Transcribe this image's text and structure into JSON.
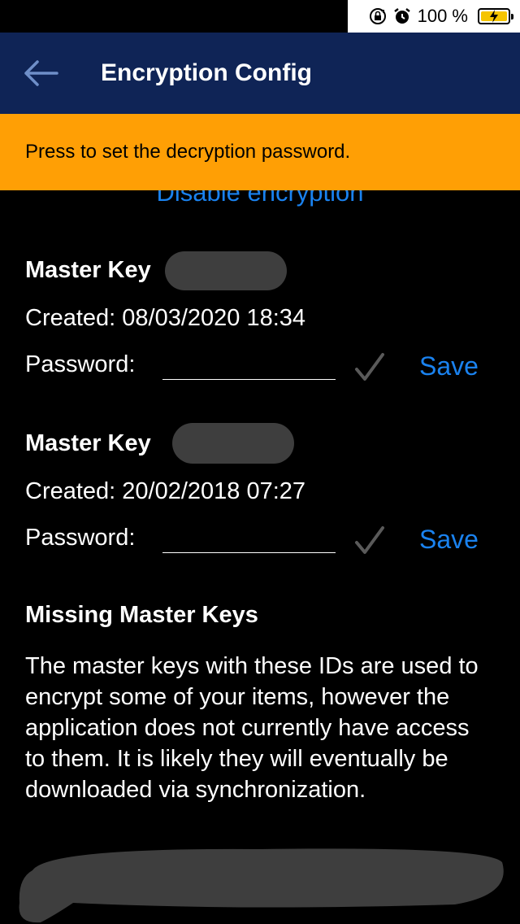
{
  "status_bar": {
    "battery_text": "100 %",
    "battery_level": 1.0
  },
  "header": {
    "title": "Encryption Config"
  },
  "banner": {
    "text": "Press to set the decryption password."
  },
  "disable_link": "Disable encryption",
  "master_keys": [
    {
      "title": "Master Key",
      "created": "Created: 08/03/2020 18:34",
      "password_label": "Password:",
      "password_value": "",
      "save_label": "Save"
    },
    {
      "title": "Master Key",
      "created": "Created: 20/02/2018 07:27",
      "password_label": "Password:",
      "password_value": "",
      "save_label": "Save"
    }
  ],
  "missing": {
    "title": "Missing Master Keys",
    "description": "The master keys with these IDs are used to encrypt some of your items, however the application does not currently have access to them. It is likely they will eventually be downloaded via synchronization."
  },
  "colors": {
    "header_bg": "#0f2456",
    "banner_bg": "#ff9f05",
    "link": "#1a82ef",
    "background": "#000000"
  }
}
